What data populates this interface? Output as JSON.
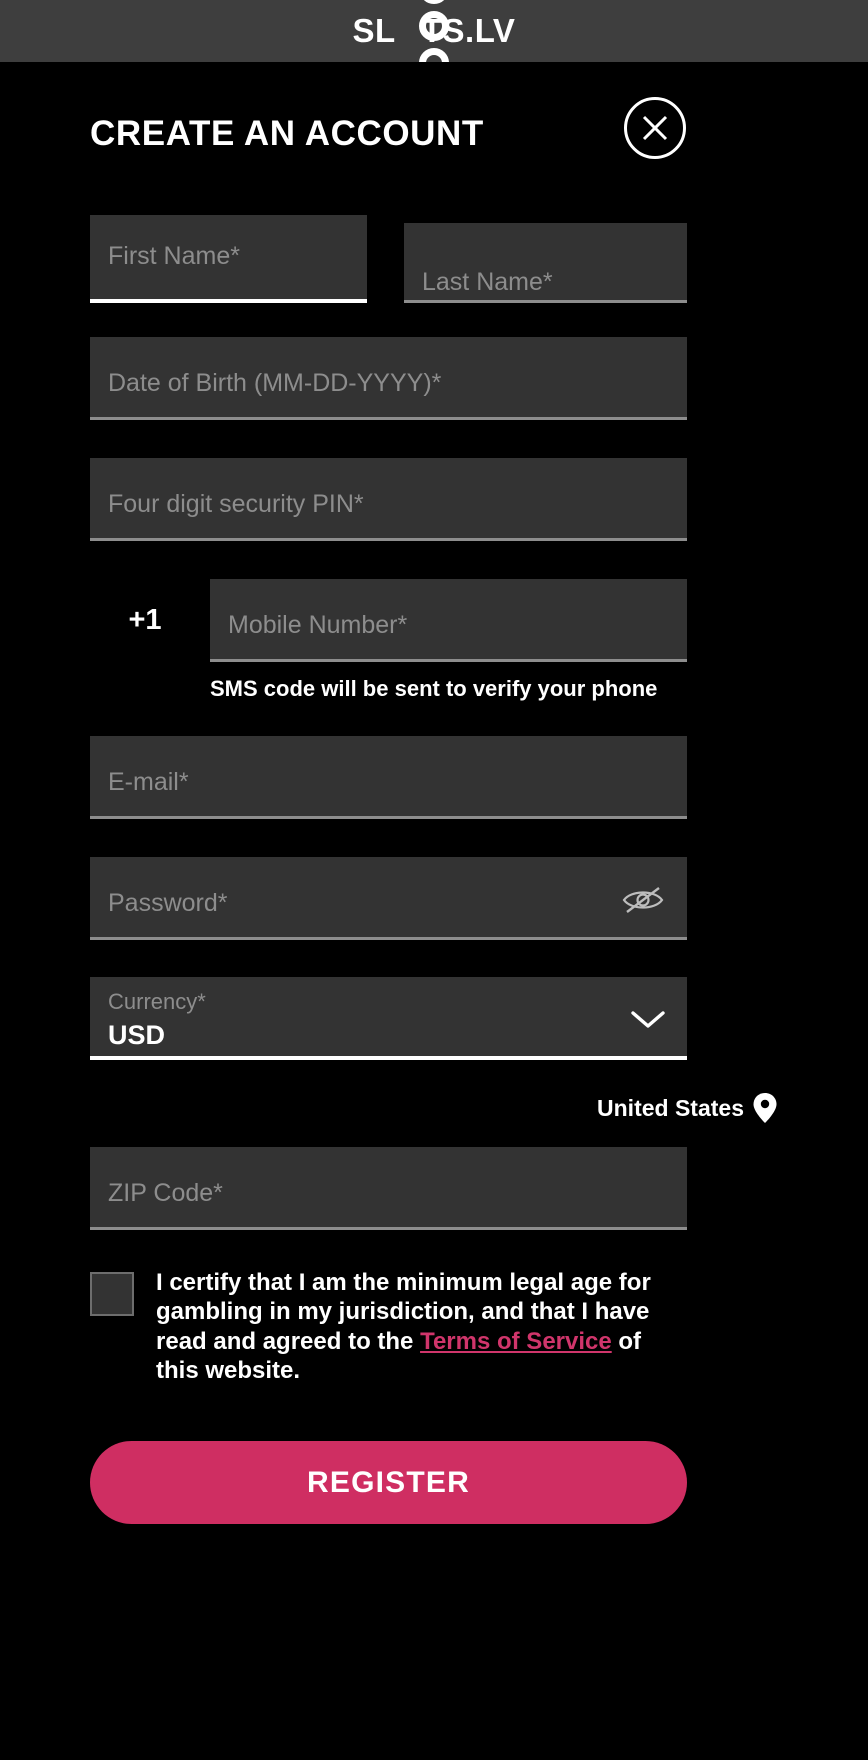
{
  "header": {
    "logo_pre": "SL",
    "logo_o": "O",
    "logo_post": "TS.LV",
    "logo_full": "SLOTS.LV",
    "reel_symbol": "O"
  },
  "dialog": {
    "title": "CREATE AN ACCOUNT",
    "close_label": "close-icon"
  },
  "form": {
    "first_name": {
      "placeholder": "First Name*",
      "value": "",
      "focused": true
    },
    "last_name": {
      "placeholder": "Last Name*",
      "value": ""
    },
    "date_of_birth": {
      "placeholder": "Date of Birth (MM-DD-YYYY)*",
      "value": ""
    },
    "pin": {
      "placeholder": "Four digit security PIN*",
      "value": ""
    },
    "country_code": "+1",
    "mobile": {
      "placeholder": "Mobile Number*",
      "value": ""
    },
    "sms_note": "SMS code will be sent to verify your phone",
    "email": {
      "placeholder": "E-mail*",
      "value": ""
    },
    "password": {
      "placeholder": "Password*",
      "value": "",
      "toggle_icon": "eye-off-icon"
    },
    "currency": {
      "label": "Currency*",
      "value": "USD",
      "chevron": "chevron-down-icon"
    },
    "country": {
      "name": "United States",
      "icon": "location-pin-icon"
    },
    "zip": {
      "placeholder": "ZIP Code*",
      "value": ""
    }
  },
  "consent": {
    "checked": false,
    "text_before": "I certify that I am the minimum legal age for gambling in my jurisdiction, and that I have read and agreed to the ",
    "link_text": "Terms of Service",
    "text_after": " of this website."
  },
  "actions": {
    "register_label": "REGISTER"
  },
  "colors": {
    "background": "#000000",
    "header_bar": "#3e3e3e",
    "field_bg": "#333333",
    "placeholder": "#8d8d8d",
    "underline": "#8d8d8d",
    "underline_active": "#ffffff",
    "accent": "#cf2e62",
    "link": "#d0356b"
  }
}
